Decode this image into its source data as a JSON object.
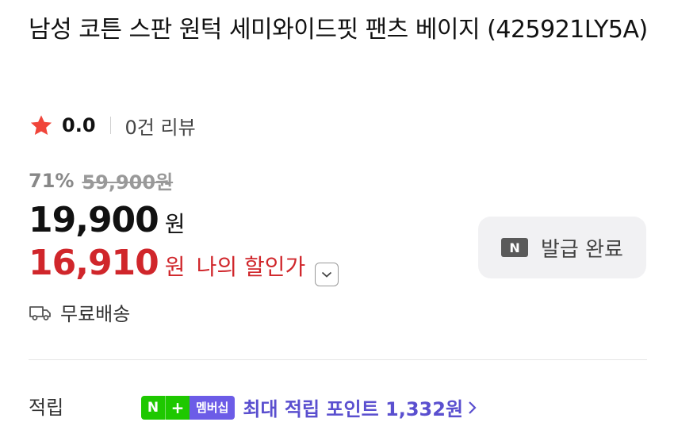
{
  "product": {
    "title": "남성 코튼 스판 원턱 세미와이드핏 팬츠 베이지 (425921LY5A)"
  },
  "rating": {
    "score": "0.0",
    "reviews": "0건 리뷰"
  },
  "pricing": {
    "discount_rate": "71%",
    "original_price": "59,900원",
    "sale_price": "19,900",
    "sale_unit": "원",
    "my_price": "16,910",
    "my_unit": "원",
    "my_label": "나의 할인가"
  },
  "coupon_button": {
    "badge": "N",
    "label": "발급 완료"
  },
  "shipping": {
    "label": "무료배송"
  },
  "points": {
    "label": "적립",
    "badge_n": "N",
    "badge_plus": "+",
    "badge_membership": "멤버십",
    "message": "최대 적립 포인트 1,332원"
  },
  "colors": {
    "accent_red": "#d0262b",
    "star": "#f0453a",
    "naver_green": "#1ec800",
    "membership_purple": "#6c5ce7"
  },
  "icons": [
    "star-icon",
    "chevron-down-icon",
    "naver-n-icon",
    "truck-icon",
    "chevron-right-icon"
  ]
}
